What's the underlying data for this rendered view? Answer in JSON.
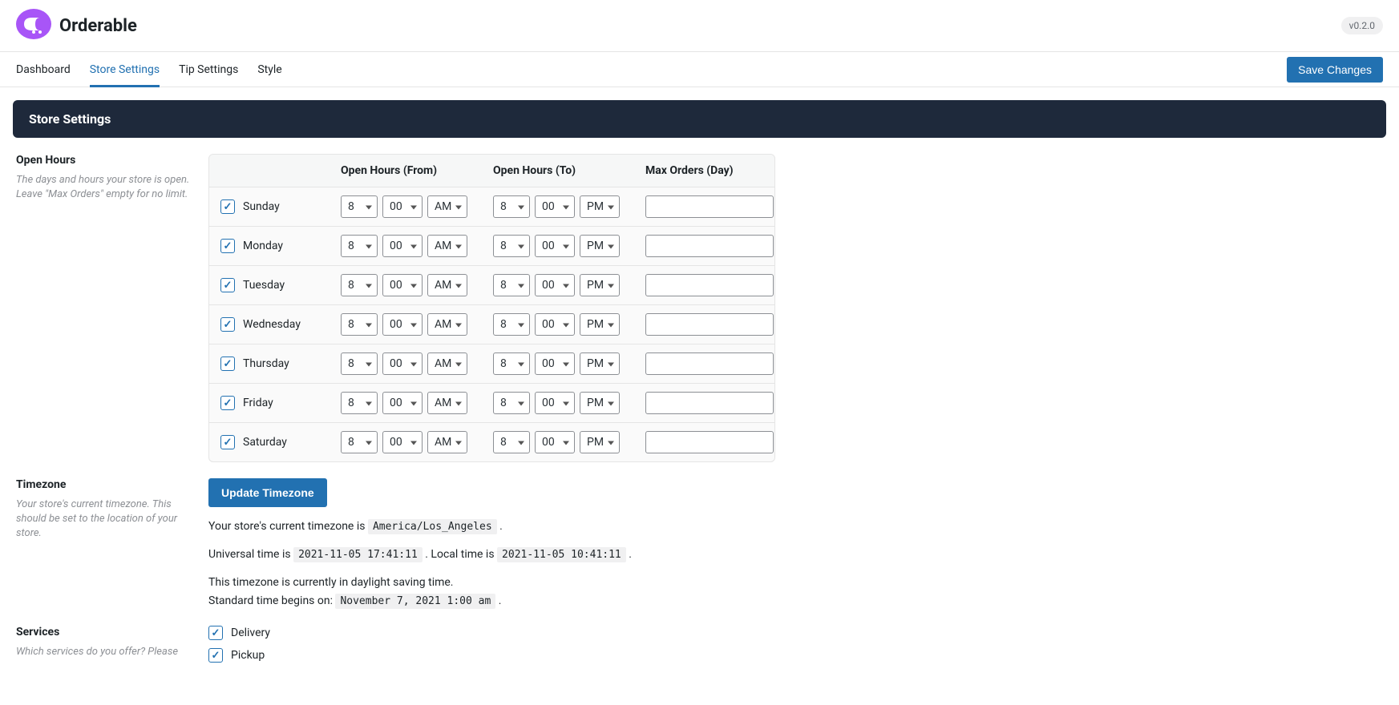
{
  "brand": {
    "name": "Orderable",
    "version": "v0.2.0"
  },
  "nav": {
    "tabs": [
      {
        "label": "Dashboard"
      },
      {
        "label": "Store Settings"
      },
      {
        "label": "Tip Settings"
      },
      {
        "label": "Style"
      }
    ],
    "save_label": "Save Changes"
  },
  "page_title": "Store Settings",
  "open_hours": {
    "title": "Open Hours",
    "desc": "The days and hours your store is open. Leave \"Max Orders\" empty for no limit.",
    "headers": {
      "from": "Open Hours (From)",
      "to": "Open Hours (To)",
      "max": "Max Orders (Day)"
    },
    "days": [
      {
        "name": "Sunday",
        "checked": true,
        "from_h": "8",
        "from_m": "00",
        "from_p": "AM",
        "to_h": "8",
        "to_m": "00",
        "to_p": "PM",
        "max": ""
      },
      {
        "name": "Monday",
        "checked": true,
        "from_h": "8",
        "from_m": "00",
        "from_p": "AM",
        "to_h": "8",
        "to_m": "00",
        "to_p": "PM",
        "max": ""
      },
      {
        "name": "Tuesday",
        "checked": true,
        "from_h": "8",
        "from_m": "00",
        "from_p": "AM",
        "to_h": "8",
        "to_m": "00",
        "to_p": "PM",
        "max": ""
      },
      {
        "name": "Wednesday",
        "checked": true,
        "from_h": "8",
        "from_m": "00",
        "from_p": "AM",
        "to_h": "8",
        "to_m": "00",
        "to_p": "PM",
        "max": ""
      },
      {
        "name": "Thursday",
        "checked": true,
        "from_h": "8",
        "from_m": "00",
        "from_p": "AM",
        "to_h": "8",
        "to_m": "00",
        "to_p": "PM",
        "max": ""
      },
      {
        "name": "Friday",
        "checked": true,
        "from_h": "8",
        "from_m": "00",
        "from_p": "AM",
        "to_h": "8",
        "to_m": "00",
        "to_p": "PM",
        "max": ""
      },
      {
        "name": "Saturday",
        "checked": true,
        "from_h": "8",
        "from_m": "00",
        "from_p": "AM",
        "to_h": "8",
        "to_m": "00",
        "to_p": "PM",
        "max": ""
      }
    ]
  },
  "timezone": {
    "title": "Timezone",
    "desc": "Your store's current timezone. This should be set to the location of your store.",
    "button": "Update Timezone",
    "line1_pre": "Your store's current timezone is ",
    "tz_value": "America/Los_Angeles",
    "line2_pre": "Universal time is ",
    "utc_value": "2021-11-05 17:41:11",
    "line2_mid": ". Local time is ",
    "local_value": "2021-11-05 10:41:11",
    "line3": "This timezone is currently in daylight saving time.",
    "line4_pre": "Standard time begins on: ",
    "std_begin": "November 7, 2021 1:00 am"
  },
  "services": {
    "title": "Services",
    "desc": "Which services do you offer? Please",
    "items": [
      {
        "label": "Delivery",
        "checked": true
      },
      {
        "label": "Pickup",
        "checked": true
      }
    ]
  }
}
